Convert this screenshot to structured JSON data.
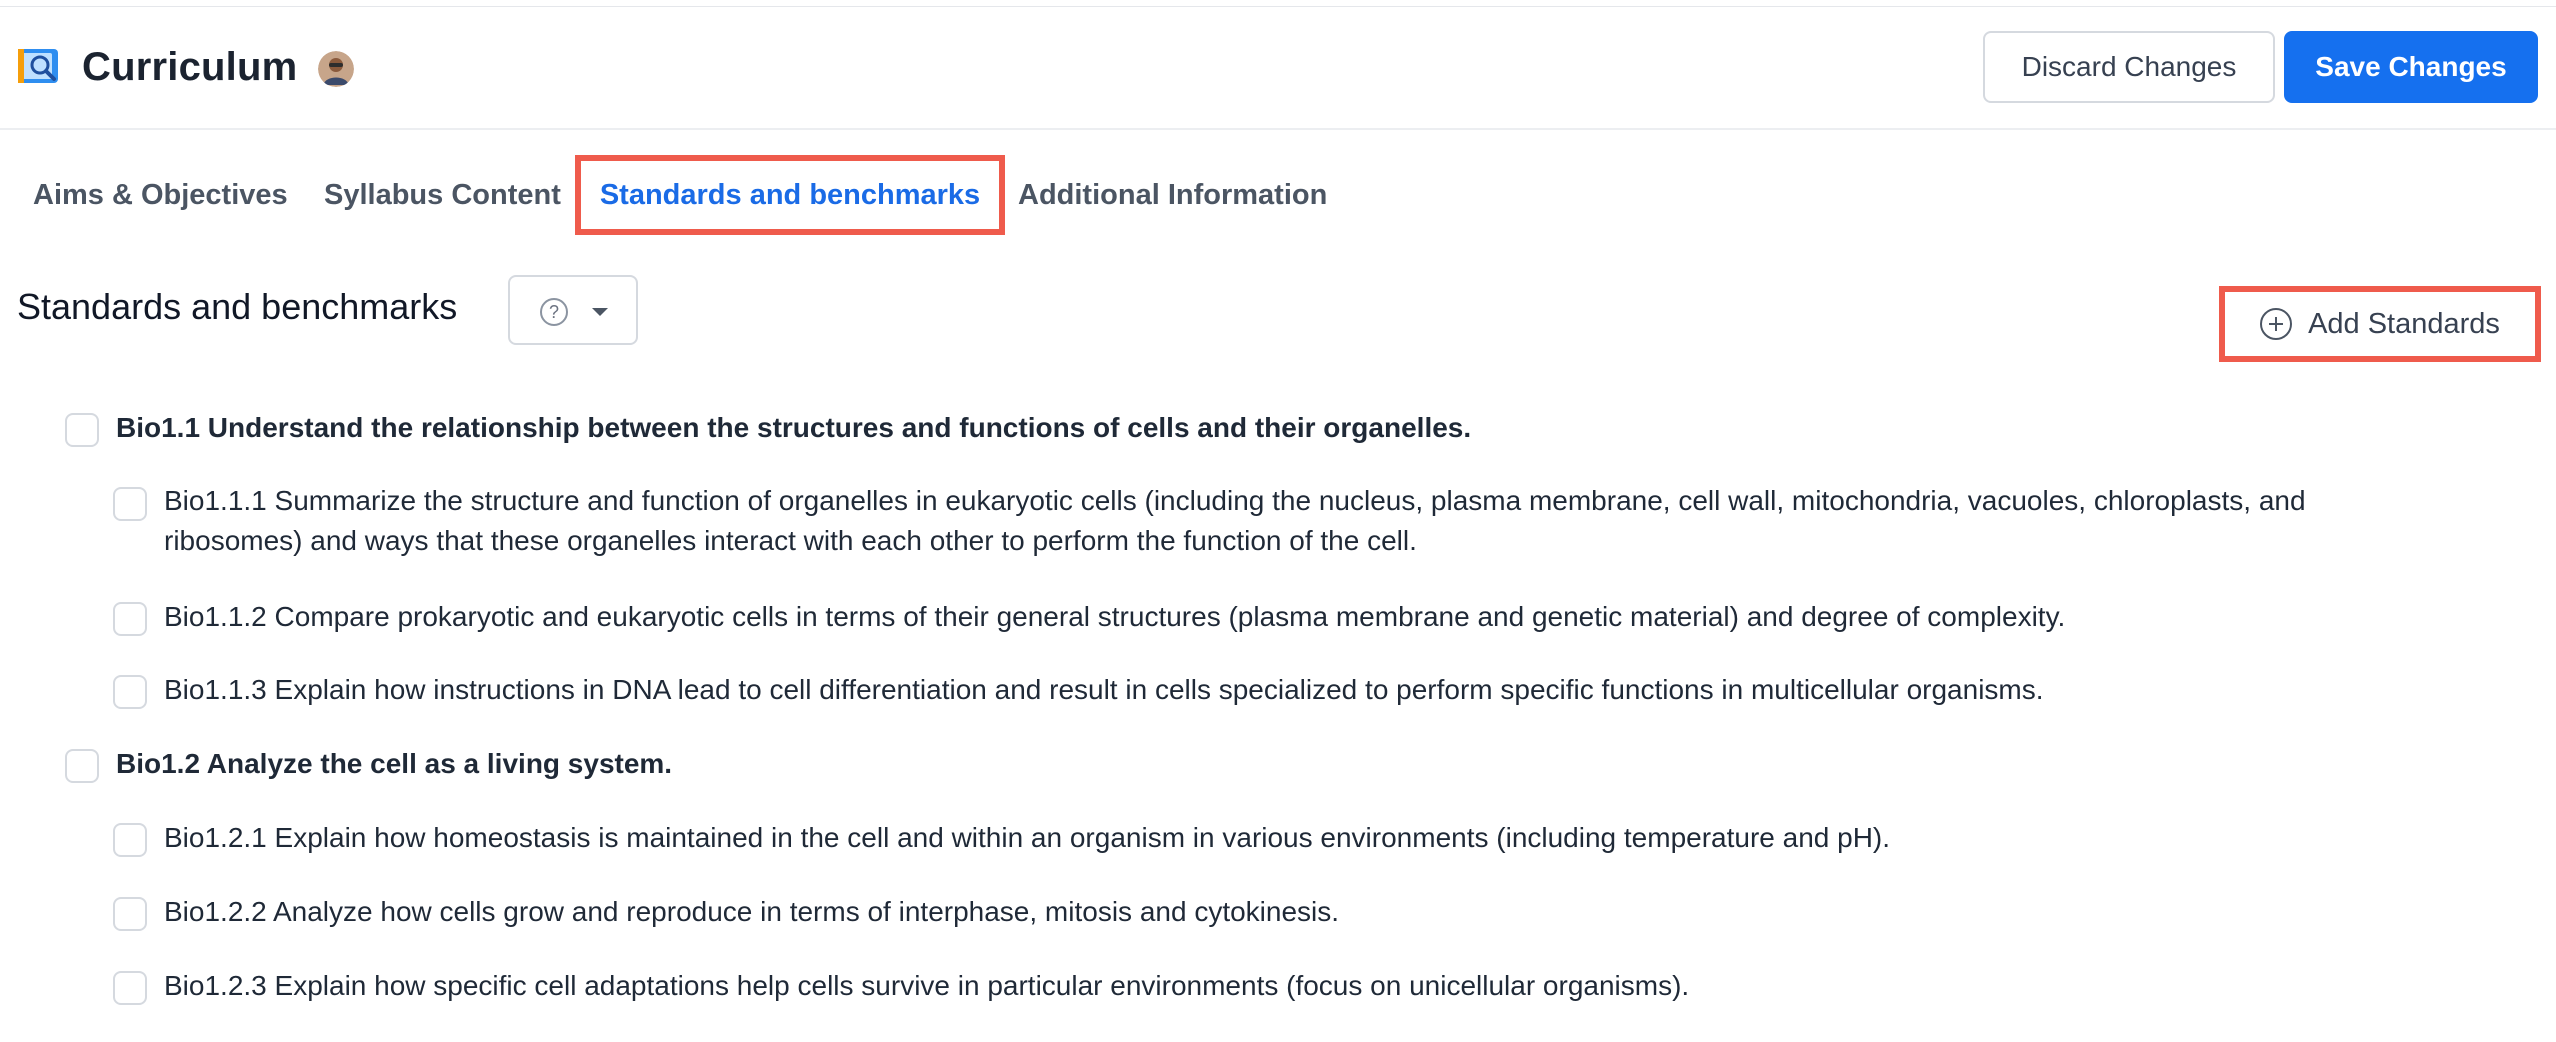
{
  "header": {
    "title": "Curriculum",
    "app_icon": "curriculum-book-search-icon",
    "avatar": "user-avatar",
    "discard_label": "Discard Changes",
    "save_label": "Save Changes"
  },
  "tabs": [
    {
      "label": "Aims & Objectives",
      "active": false
    },
    {
      "label": "Syllabus Content",
      "active": false
    },
    {
      "label": "Standards and benchmarks",
      "active": true
    },
    {
      "label": "Additional Information",
      "active": false
    }
  ],
  "section": {
    "heading": "Standards and benchmarks",
    "help_icon": "question-circle-icon",
    "dropdown_icon": "caret-down-icon",
    "add_label": "Add Standards",
    "add_icon": "plus-circle-icon"
  },
  "standards": [
    {
      "code": "Bio1.1",
      "text": "Bio1.1 Understand the relationship between the structures and functions of cells and their organelles.",
      "level": 1
    },
    {
      "code": "Bio1.1.1",
      "text_line1": "Bio1.1.1 Summarize the structure and function of organelles in eukaryotic cells (including the nucleus, plasma membrane, cell wall, mitochondria, vacuoles, chloroplasts, and",
      "text_line2": "ribosomes) and ways that these organelles interact with each other to perform the function of the cell.",
      "level": 2
    },
    {
      "code": "Bio1.1.2",
      "text": "Bio1.1.2 Compare prokaryotic and eukaryotic cells in terms of their general structures (plasma membrane and genetic material) and degree of complexity.",
      "level": 2
    },
    {
      "code": "Bio1.1.3",
      "text": "Bio1.1.3 Explain how instructions in DNA lead to cell differentiation and result in cells specialized to perform specific functions in multicellular organisms.",
      "level": 2
    },
    {
      "code": "Bio1.2",
      "text": "Bio1.2 Analyze the cell as a living system.",
      "level": 1
    },
    {
      "code": "Bio1.2.1",
      "text": "Bio1.2.1 Explain how homeostasis is maintained in the cell and within an organism in various environments (including temperature and pH).",
      "level": 2
    },
    {
      "code": "Bio1.2.2",
      "text": "Bio1.2.2 Analyze how cells grow and reproduce in terms of interphase, mitosis and cytokinesis.",
      "level": 2
    },
    {
      "code": "Bio1.2.3",
      "text": "Bio1.2.3 Explain how specific cell adaptations help cells survive in particular environments (focus on unicellular organisms).",
      "level": 2
    }
  ],
  "colors": {
    "primary": "#1570ef",
    "highlight_box": "#ef5b4c",
    "active_tab_text": "#1a6be6"
  }
}
